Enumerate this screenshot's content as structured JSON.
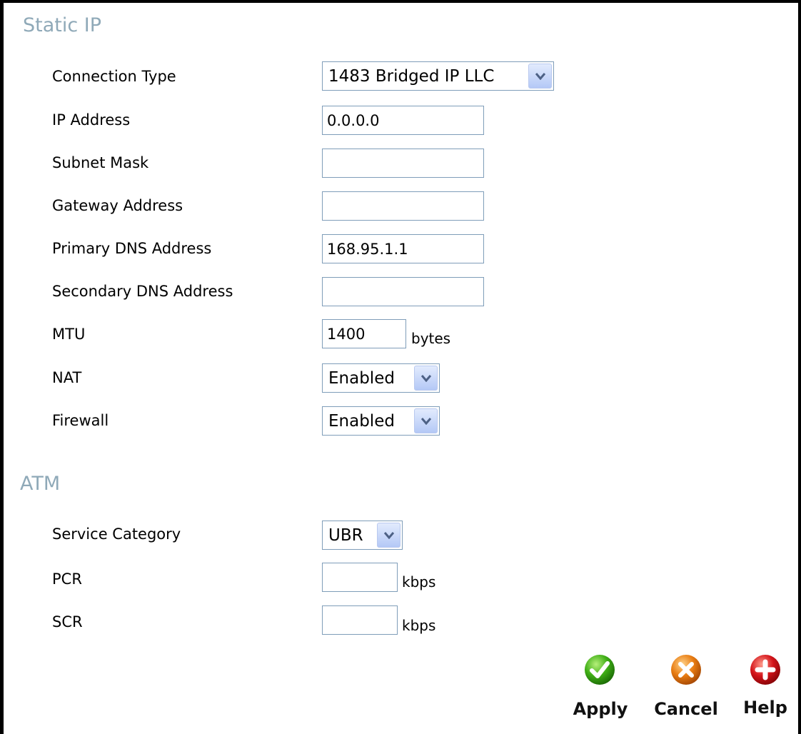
{
  "static_ip": {
    "title": "Static IP",
    "connection_type": {
      "label": "Connection Type",
      "value": "1483 Bridged IP LLC"
    },
    "ip_address": {
      "label": "IP Address",
      "value": "0.0.0.0"
    },
    "subnet_mask": {
      "label": "Subnet Mask",
      "value": ""
    },
    "gateway_address": {
      "label": "Gateway Address",
      "value": ""
    },
    "primary_dns": {
      "label": "Primary DNS Address",
      "value": "168.95.1.1"
    },
    "secondary_dns": {
      "label": "Secondary DNS Address",
      "value": ""
    },
    "mtu": {
      "label": "MTU",
      "value": "1400",
      "unit": "bytes"
    },
    "nat": {
      "label": "NAT",
      "value": "Enabled"
    },
    "firewall": {
      "label": "Firewall",
      "value": "Enabled"
    }
  },
  "atm": {
    "title": "ATM",
    "service_category": {
      "label": "Service Category",
      "value": "UBR"
    },
    "pcr": {
      "label": "PCR",
      "value": "",
      "unit": "kbps"
    },
    "scr": {
      "label": "SCR",
      "value": "",
      "unit": "kbps"
    }
  },
  "actions": {
    "apply": {
      "label": "Apply",
      "icon": "check-icon",
      "color": "#3fae16"
    },
    "cancel": {
      "label": "Cancel",
      "icon": "x-icon",
      "color": "#e87c12"
    },
    "help": {
      "label": "Help",
      "icon": "plus-icon",
      "color": "#d4141a"
    }
  }
}
